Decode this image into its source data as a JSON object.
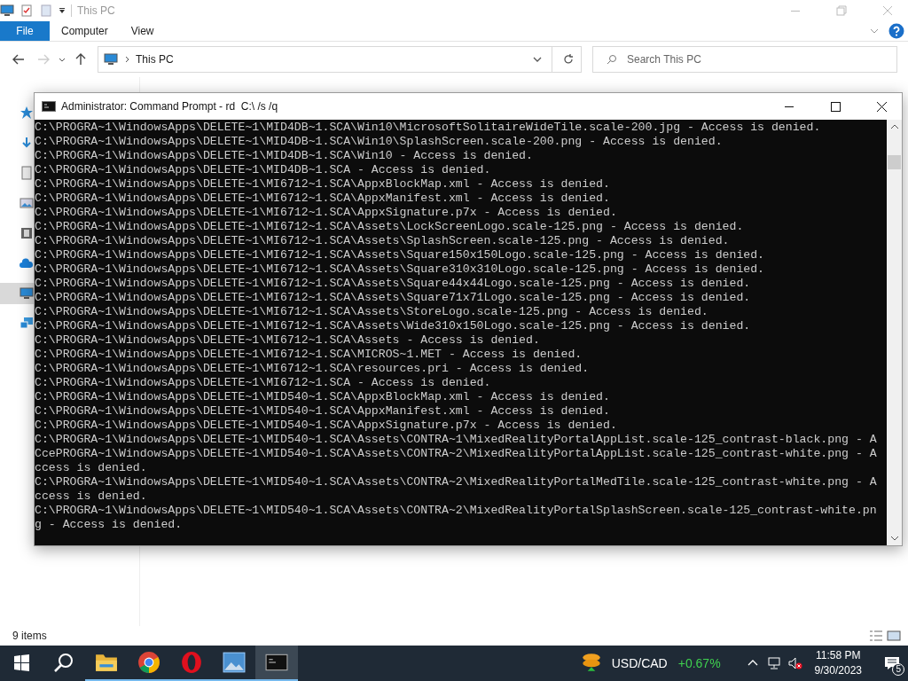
{
  "explorer": {
    "title": "This PC",
    "file_tab": "File",
    "tabs": [
      "Computer",
      "View"
    ],
    "address": "This PC",
    "search": {
      "placeholder": "Search This PC"
    },
    "nav_items": [
      {
        "kind": "star",
        "selected": false
      },
      {
        "kind": "download",
        "selected": false
      },
      {
        "kind": "document",
        "selected": false
      },
      {
        "kind": "picture",
        "selected": false
      },
      {
        "kind": "film",
        "selected": false
      },
      {
        "kind": "cloud",
        "selected": false
      },
      {
        "kind": "computer",
        "selected": true
      },
      {
        "kind": "network",
        "selected": false
      }
    ],
    "status": "9 items"
  },
  "cmd": {
    "title": "Administrator: Command Prompt - rd  C:\\ /s /q",
    "lines": [
      "C:\\PROGRA~1\\WindowsApps\\DELETE~1\\MID4DB~1.SCA\\Win10\\MicrosoftSolitaireWideTile.scale-200.jpg - Access is denied.",
      "C:\\PROGRA~1\\WindowsApps\\DELETE~1\\MID4DB~1.SCA\\Win10\\SplashScreen.scale-200.png - Access is denied.",
      "C:\\PROGRA~1\\WindowsApps\\DELETE~1\\MID4DB~1.SCA\\Win10 - Access is denied.",
      "C:\\PROGRA~1\\WindowsApps\\DELETE~1\\MID4DB~1.SCA - Access is denied.",
      "C:\\PROGRA~1\\WindowsApps\\DELETE~1\\MI6712~1.SCA\\AppxBlockMap.xml - Access is denied.",
      "C:\\PROGRA~1\\WindowsApps\\DELETE~1\\MI6712~1.SCA\\AppxManifest.xml - Access is denied.",
      "C:\\PROGRA~1\\WindowsApps\\DELETE~1\\MI6712~1.SCA\\AppxSignature.p7x - Access is denied.",
      "C:\\PROGRA~1\\WindowsApps\\DELETE~1\\MI6712~1.SCA\\Assets\\LockScreenLogo.scale-125.png - Access is denied.",
      "C:\\PROGRA~1\\WindowsApps\\DELETE~1\\MI6712~1.SCA\\Assets\\SplashScreen.scale-125.png - Access is denied.",
      "C:\\PROGRA~1\\WindowsApps\\DELETE~1\\MI6712~1.SCA\\Assets\\Square150x150Logo.scale-125.png - Access is denied.",
      "C:\\PROGRA~1\\WindowsApps\\DELETE~1\\MI6712~1.SCA\\Assets\\Square310x310Logo.scale-125.png - Access is denied.",
      "C:\\PROGRA~1\\WindowsApps\\DELETE~1\\MI6712~1.SCA\\Assets\\Square44x44Logo.scale-125.png - Access is denied.",
      "C:\\PROGRA~1\\WindowsApps\\DELETE~1\\MI6712~1.SCA\\Assets\\Square71x71Logo.scale-125.png - Access is denied.",
      "C:\\PROGRA~1\\WindowsApps\\DELETE~1\\MI6712~1.SCA\\Assets\\StoreLogo.scale-125.png - Access is denied.",
      "C:\\PROGRA~1\\WindowsApps\\DELETE~1\\MI6712~1.SCA\\Assets\\Wide310x150Logo.scale-125.png - Access is denied.",
      "C:\\PROGRA~1\\WindowsApps\\DELETE~1\\MI6712~1.SCA\\Assets - Access is denied.",
      "C:\\PROGRA~1\\WindowsApps\\DELETE~1\\MI6712~1.SCA\\MICROS~1.MET - Access is denied.",
      "C:\\PROGRA~1\\WindowsApps\\DELETE~1\\MI6712~1.SCA\\resources.pri - Access is denied.",
      "C:\\PROGRA~1\\WindowsApps\\DELETE~1\\MI6712~1.SCA - Access is denied.",
      "C:\\PROGRA~1\\WindowsApps\\DELETE~1\\MID540~1.SCA\\AppxBlockMap.xml - Access is denied.",
      "C:\\PROGRA~1\\WindowsApps\\DELETE~1\\MID540~1.SCA\\AppxManifest.xml - Access is denied.",
      "C:\\PROGRA~1\\WindowsApps\\DELETE~1\\MID540~1.SCA\\AppxSignature.p7x - Access is denied.",
      "C:\\PROGRA~1\\WindowsApps\\DELETE~1\\MID540~1.SCA\\Assets\\CONTRA~1\\MixedRealityPortalAppList.scale-125_contrast-black.png - A",
      "CcePROGRA~1\\WindowsApps\\DELETE~1\\MID540~1.SCA\\Assets\\CONTRA~2\\MixedRealityPortalAppList.scale-125_contrast-white.png - A",
      "ccess is denied.",
      "C:\\PROGRA~1\\WindowsApps\\DELETE~1\\MID540~1.SCA\\Assets\\CONTRA~2\\MixedRealityPortalMedTile.scale-125_contrast-white.png - A",
      "ccess is denied.",
      "C:\\PROGRA~1\\WindowsApps\\DELETE~1\\MID540~1.SCA\\Assets\\CONTRA~2\\MixedRealityPortalSplashScreen.scale-125_contrast-white.pn",
      "g - Access is denied."
    ]
  },
  "taskbar": {
    "apps": [
      {
        "kind": "folder",
        "active": false
      },
      {
        "kind": "chrome",
        "active": false
      },
      {
        "kind": "opera",
        "active": false
      },
      {
        "kind": "picture",
        "active": false
      },
      {
        "kind": "console",
        "active": true
      }
    ],
    "ticker": {
      "symbol": "USD/CAD",
      "change": "+0.67%"
    },
    "volume_muted": true,
    "time": "11:58 PM",
    "date": "9/30/2023",
    "notifications": "5"
  }
}
